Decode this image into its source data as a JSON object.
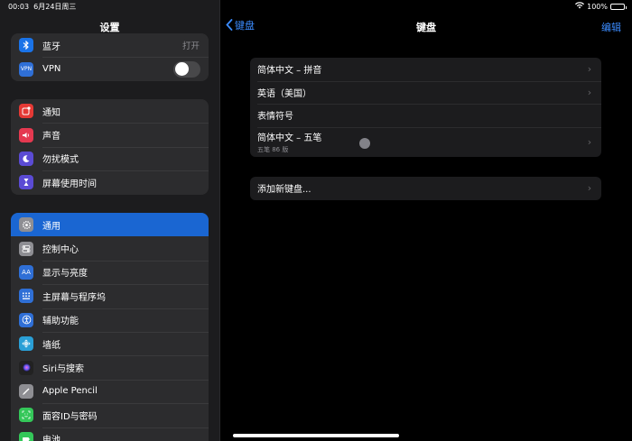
{
  "status": {
    "time": "00:03",
    "date": "6月24日周三",
    "battery": "100%",
    "battery_level": 1.0
  },
  "sidebar": {
    "title": "设置",
    "group1": [
      {
        "label": "蓝牙",
        "value": "打开",
        "icon": "bluetooth-icon",
        "color": "#1a73e8"
      },
      {
        "label": "VPN",
        "icon": "vpn-icon",
        "color": "#2f6fd6",
        "toggle": false
      }
    ],
    "group2": [
      {
        "label": "通知",
        "icon": "notification-icon",
        "color": "#e53935"
      },
      {
        "label": "声音",
        "icon": "speaker-icon",
        "color": "#e53950"
      },
      {
        "label": "勿扰模式",
        "icon": "moon-icon",
        "color": "#5b4bd4"
      },
      {
        "label": "屏幕使用时间",
        "icon": "hourglass-icon",
        "color": "#5b4bd4"
      }
    ],
    "group3": [
      {
        "label": "通用",
        "icon": "gear-icon",
        "color": "#8e8e93",
        "selected": true
      },
      {
        "label": "控制中心",
        "icon": "control-center-icon",
        "color": "#8e8e93"
      },
      {
        "label": "显示与亮度",
        "icon": "display-icon",
        "color": "#2f6fd6"
      },
      {
        "label": "主屏幕与程序坞",
        "icon": "home-screen-icon",
        "color": "#2f6fd6"
      },
      {
        "label": "辅助功能",
        "icon": "accessibility-icon",
        "color": "#2f6fd6"
      },
      {
        "label": "墙纸",
        "icon": "wallpaper-icon",
        "color": "#2a9fd6"
      },
      {
        "label": "Siri与搜索",
        "icon": "siri-icon",
        "color": "#222"
      },
      {
        "label": "Apple Pencil",
        "icon": "pencil-icon",
        "color": "#8e8e93"
      },
      {
        "label": "面容ID与密码",
        "icon": "faceid-icon",
        "color": "#34c759"
      },
      {
        "label": "电池",
        "icon": "battery-icon",
        "color": "#34c759"
      }
    ]
  },
  "main": {
    "back_label": "键盘",
    "title": "键盘",
    "edit_label": "编辑",
    "keyboards": [
      {
        "label": "简体中文 – 拼音"
      },
      {
        "label": "英语（美国）"
      },
      {
        "label": "表情符号"
      },
      {
        "label": "简体中文 – 五笔",
        "sub": "五笔 86 版"
      }
    ],
    "add_label": "添加新键盘..."
  }
}
